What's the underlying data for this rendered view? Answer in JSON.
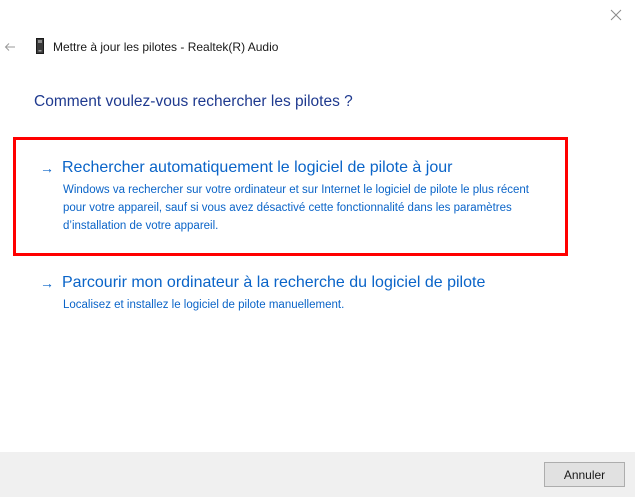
{
  "window": {
    "header_title": "Mettre à jour les pilotes - Realtek(R) Audio",
    "close_icon": "close-icon",
    "back_icon": "back-arrow-icon",
    "device_icon": "audio-device-icon"
  },
  "main": {
    "question": "Comment voulez-vous rechercher les pilotes ?",
    "options": [
      {
        "icon": "arrow-right-icon",
        "arrow": "→",
        "title": "Rechercher automatiquement le logiciel de pilote à jour",
        "description": "Windows va rechercher sur votre ordinateur et sur Internet le logiciel de pilote le plus récent pour votre appareil, sauf si vous avez désactivé cette fonctionnalité dans les paramètres d’installation de votre appareil.",
        "highlighted": true
      },
      {
        "icon": "arrow-right-icon",
        "arrow": "→",
        "title": "Parcourir mon ordinateur à la recherche du logiciel de pilote",
        "description": "Localisez et installez le logiciel de pilote manuellement.",
        "highlighted": false
      }
    ]
  },
  "footer": {
    "cancel_label": "Annuler"
  },
  "colors": {
    "link": "#0a64c8",
    "question": "#1f3a8f",
    "highlight_border": "#ff0000",
    "footer_bg": "#f0f0f0"
  }
}
